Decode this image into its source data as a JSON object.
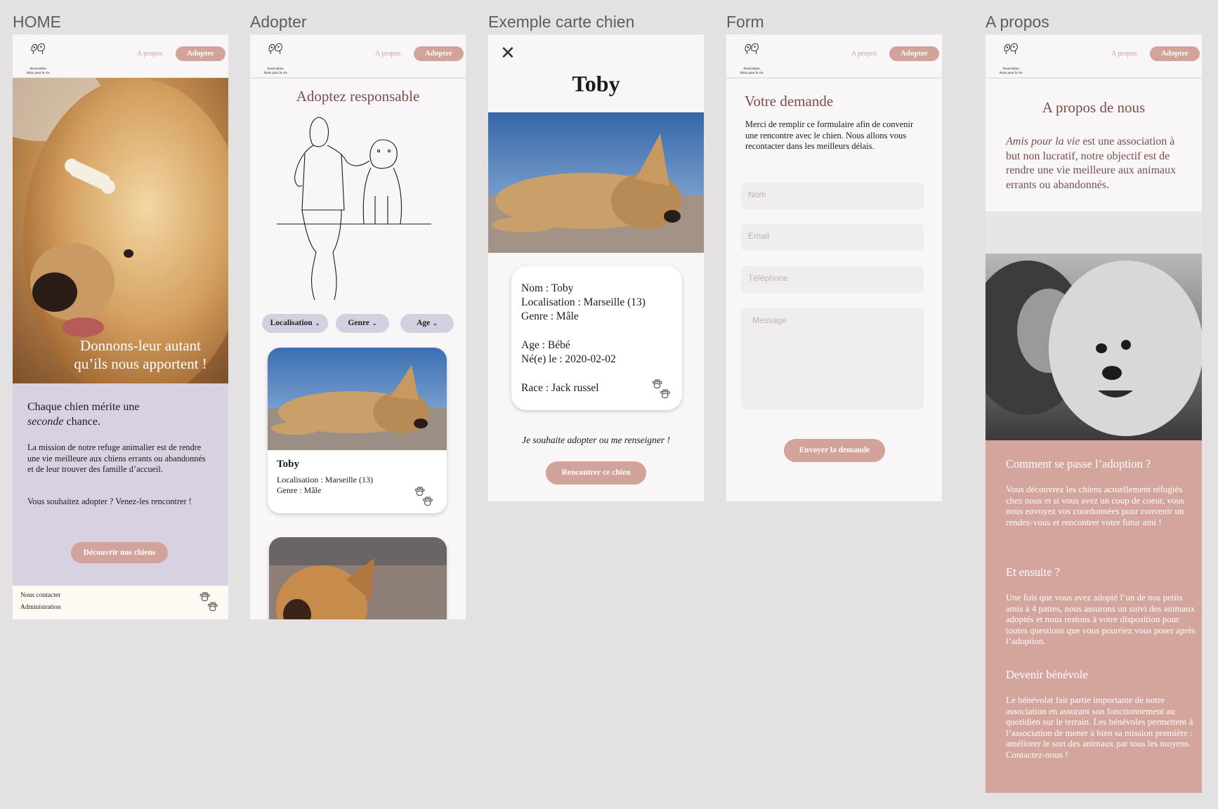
{
  "frames": {
    "home": "HOME",
    "adopter": "Adopter",
    "exemple": "Exemple carte chien",
    "form": "Form",
    "apropos": "A propos"
  },
  "nav": {
    "apropos": "A propos",
    "adopter": "Adopter"
  },
  "logo": {
    "line1": "Association",
    "line2": "Amis pour la vie"
  },
  "home": {
    "hero_line1": "Donnons-leur autant",
    "hero_line2": "qu’ils nous apportent !",
    "lead_1": "Chaque chien mérite une",
    "lead_em": "seconde",
    "lead_2": " chance.",
    "p1": "La mission de notre refuge animalier est de rendre une vie meilleure aux chiens errants ou abandonnés et de leur trouver des famille d’accueil.",
    "p2": "Vous souhaitez adopter ? Venez-les rencontrer !",
    "cta": "Découvrir nos chiens",
    "footer_contact": "Nous contacter",
    "footer_admin": "Administration"
  },
  "adopter": {
    "title": "Adoptez responsable",
    "filters": [
      "Localisation",
      "Genre",
      "Age"
    ],
    "card_name": "Toby",
    "card_loc": "Localisation : Marseille (13)",
    "card_genre": "Genre : Mâle"
  },
  "exemple": {
    "name": "Toby",
    "nom": "Nom : Toby",
    "loc": "Localisation : Marseille (13)",
    "genre": "Genre : Mâle",
    "age": "Age : Bébé",
    "ne": "Né(e) le : 2020-02-02",
    "race": "Race : Jack russel",
    "question": "Je souhaite adopter ou me renseigner !",
    "cta": "Rencontrer ce chien"
  },
  "form": {
    "title": "Votre demande",
    "intro": "Merci de remplir ce formulaire afin de convenir une rencontre avec le chien. Nous allons vous recontacter dans les meilleurs délais.",
    "nom_ph": "Nom",
    "email_ph": "Email",
    "tel_ph": "Téléphone",
    "msg_ph": "Message",
    "submit": "Envoyer la demande"
  },
  "apropos": {
    "title": "A propos de nous",
    "intro_em": "Amis pour la vie",
    "intro_rest": " est une association à but non lucratif, notre objectif est de rendre une vie meilleure aux animaux errants ou abandonnés.",
    "h1": "Comment se passe l’adoption ?",
    "p1": "Vous découvrez les chiens actuellement réfugiés chez nous et si vous avez un coup de coeur, vous nous envoyez vos coordonnées pour convenir un rendez-vous et rencontrer votre futur ami !",
    "h2": "Et ensuite ?",
    "p2": "Une fois que vous avez adopté l’un de nos petits amis à 4 pattes, nous assurons un suivi des animaux adoptés et nous restons à votre disposition pour toutes questions que vous pourriez vous poser après l’adoption.",
    "h3": "Devenir bénévole",
    "p3": "Le bénévolat fait partie importante de notre association en assurant son fonctionnement au quotidien sur le terrain. Les bénévoles permettent à l’association de mener à bien sa mission première : améliorer le sort des animaux par tous les moyens. Contactez-nous !"
  },
  "colors": {
    "accent": "#d1a39b",
    "lavender": "#d7d1e1",
    "filter": "#d5cfe2",
    "rose_section": "#d4a59d",
    "cream": "#fdfaf3",
    "title_brown": "#7b4e4a"
  },
  "icons": [
    "paw-icon",
    "close-icon",
    "chevron-down-icon",
    "logo-dogs-icon"
  ]
}
